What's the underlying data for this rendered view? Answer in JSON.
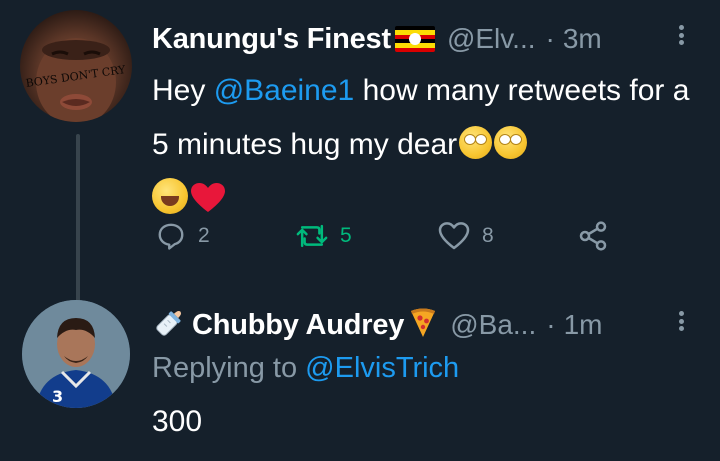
{
  "colors": {
    "background": "#15202b",
    "text_primary": "#ffffff",
    "text_secondary": "#8899a6",
    "link": "#1d9bf0",
    "retweeted": "#00ba7c",
    "thread_line": "#38444d",
    "flag_black": "#000000",
    "flag_yellow": "#fcdc04",
    "flag_red": "#d90000",
    "heart": "#e8173a",
    "pizza": "#f5a623"
  },
  "tweet": {
    "avatar": {
      "icon": "profile-photo",
      "text": "BOYS DON'T CRY"
    },
    "display_name": "Kanungu's Finest",
    "flag_icon": "uganda-flag-icon",
    "handle": "@Elv...",
    "separator": "·",
    "time": "3m",
    "more_icon": "more-options-icon",
    "text": {
      "part1": "Hey ",
      "mention": "@Baeine1",
      "part2": " how many retweets for a 5 minutes hug my dear"
    },
    "emojis": [
      "face-with-rolling-eyes",
      "face-with-rolling-eyes",
      "face-with-tears-of-joy",
      "red-heart"
    ],
    "actions": {
      "reply": {
        "icon": "reply-icon",
        "count": "2"
      },
      "retweet": {
        "icon": "retweet-icon",
        "count": "5",
        "active": true
      },
      "like": {
        "icon": "like-icon",
        "count": "8"
      },
      "share": {
        "icon": "share-icon"
      }
    }
  },
  "reply": {
    "avatar": {
      "icon": "profile-photo"
    },
    "baby_bottle_icon": "baby-bottle-icon",
    "display_name": "Chubby Audrey",
    "pizza_icon": "pizza-icon",
    "handle": "@Ba...",
    "separator": "·",
    "time": "1m",
    "more_icon": "more-options-icon",
    "replying_to_label": "Replying to ",
    "replying_to_handle": "@ElvisTrich",
    "text": "300"
  }
}
